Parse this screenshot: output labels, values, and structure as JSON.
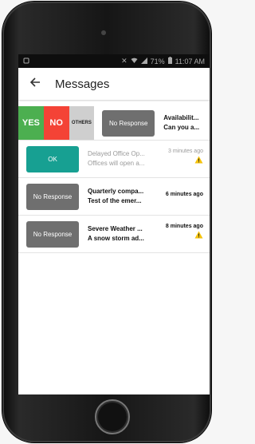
{
  "status_bar": {
    "left_icon": "notification-icon",
    "battery": "71%",
    "time": "11:07 AM"
  },
  "app_bar": {
    "back_icon": "arrow-left-icon",
    "title": "Messages"
  },
  "swipe_row": {
    "yes_label": "YES",
    "no_label": "NO",
    "others_label": "OTHERS",
    "response_label": "No Response",
    "line1": "Availabilit...",
    "line2": "Can you a..."
  },
  "messages": [
    {
      "response_label": "OK",
      "response_color": "#17a092",
      "line1": "Delayed Office Op...",
      "line2": "Offices will open a...",
      "time": "3 minutes ago",
      "read": true,
      "warning": true
    },
    {
      "response_label": "No Response",
      "response_color": "#6f6f6f",
      "line1": "Quarterly compa...",
      "line2": "Test of the emer...",
      "time": "6 minutes ago",
      "read": false,
      "warning": false
    },
    {
      "response_label": "No Response",
      "response_color": "#6f6f6f",
      "line1": "Severe Weather ...",
      "line2": "A snow storm ad...",
      "time": "8 minutes ago",
      "read": false,
      "warning": true
    }
  ],
  "colors": {
    "yes": "#4caf50",
    "no": "#f44336",
    "others": "#cfcfcf",
    "warning": "#f4c20d"
  }
}
